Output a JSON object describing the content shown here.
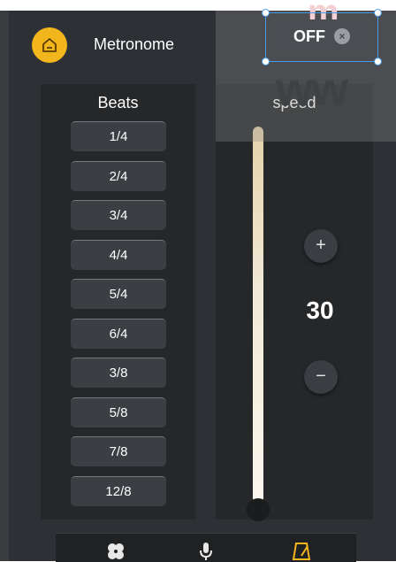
{
  "header": {
    "title": "Metronome",
    "toggle_label": "OFF",
    "toggle_close_glyph": "×"
  },
  "watermark": {
    "top_text": "m",
    "mid_text": "ww"
  },
  "beats": {
    "title": "Beats",
    "items": [
      "1/4",
      "2/4",
      "3/4",
      "4/4",
      "5/4",
      "6/4",
      "3/8",
      "5/8",
      "7/8",
      "12/8"
    ]
  },
  "speed": {
    "title": "speed",
    "value": "30",
    "plus_label": "+",
    "minus_label": "−"
  },
  "colors": {
    "accent": "#f2b51b",
    "background": "#2d3034",
    "panel": "#252729",
    "selection": "#4a9ae8"
  },
  "nav": {
    "icons": [
      "fan-icon",
      "microphone-icon",
      "metronome-icon"
    ]
  }
}
